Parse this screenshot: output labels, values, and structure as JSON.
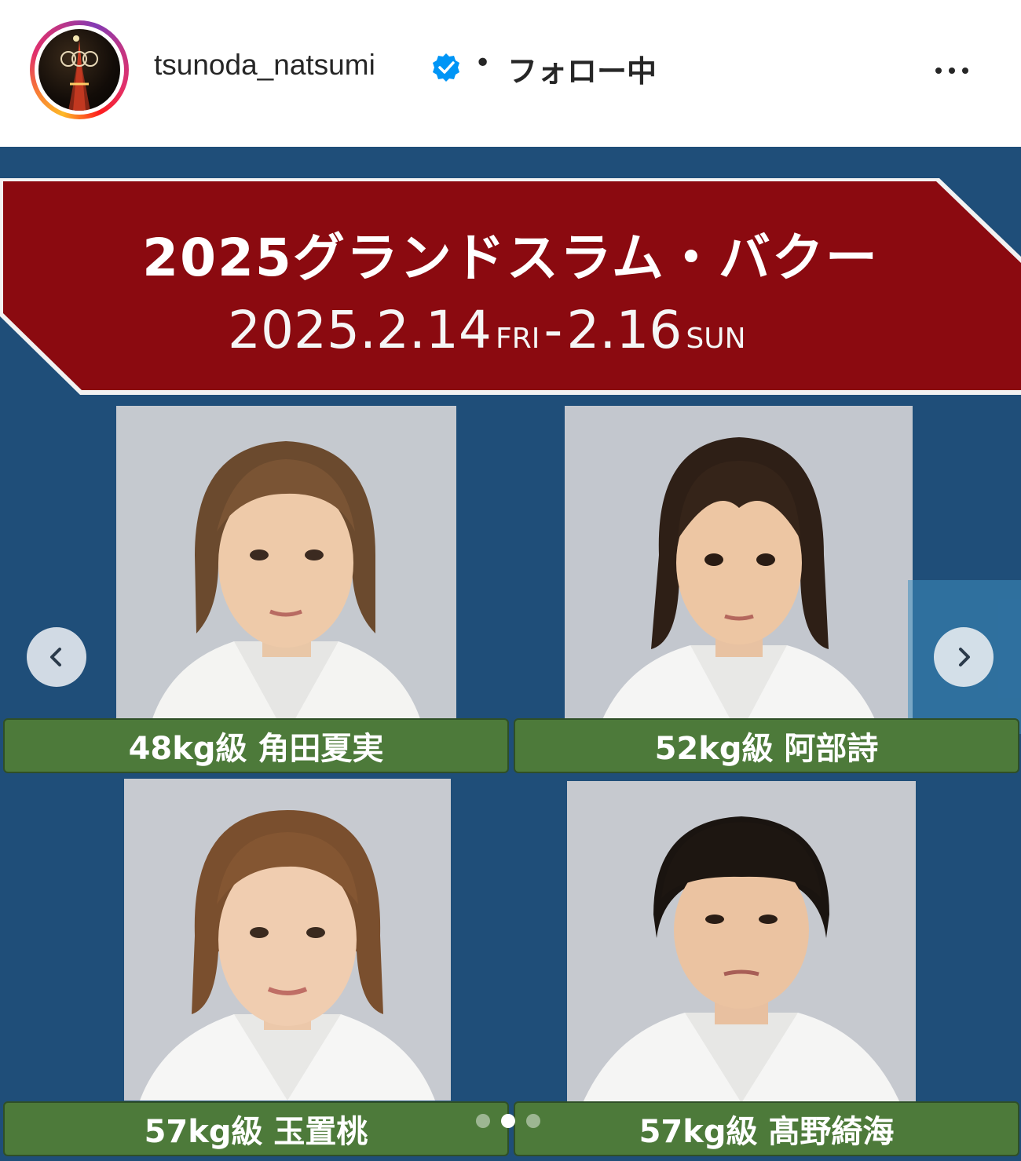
{
  "post_header": {
    "username": "tsunoda_natsumi",
    "separator": "•",
    "follow_status": "フォロー中",
    "verified_icon": "verified-badge-icon",
    "more_icon": "more-options-icon"
  },
  "post_image": {
    "title": "2025グランドスラム・バクー",
    "date_start": "2025.2.14",
    "date_start_day": "FRI",
    "date_dash": "-",
    "date_end": "2.16",
    "date_end_day": "SUN",
    "athletes": [
      {
        "label": "48kg級 角田夏実"
      },
      {
        "label": "52kg級 阿部詩"
      },
      {
        "label": "57kg級 玉置桃"
      },
      {
        "label": "57kg級 髙野綺海"
      }
    ]
  },
  "carousel": {
    "prev_icon": "chevron-left-icon",
    "next_icon": "chevron-right-icon",
    "total_slides": 3,
    "active_slide": 2
  },
  "colors": {
    "background_blue": "#1f4e79",
    "banner_red": "#8b0a10",
    "label_green": "#4d7a3a",
    "verified_blue": "#0095f6"
  }
}
